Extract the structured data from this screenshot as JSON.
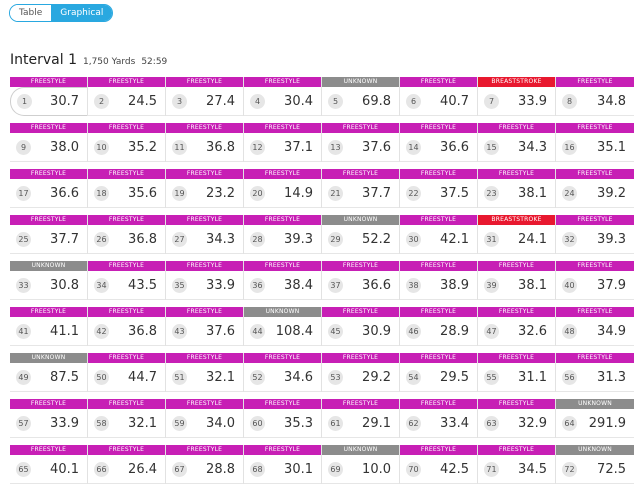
{
  "view_toggle": {
    "options": [
      "Table",
      "Graphical"
    ],
    "active": "Graphical"
  },
  "interval": {
    "title": "Interval 1",
    "yards": "1,750 Yards",
    "duration": "52:59"
  },
  "stroke_colors": {
    "FREESTYLE": "#c71fb5",
    "UNKNOWN": "#8c8c8c",
    "BREASTSTROKE": "#e8182f"
  },
  "laps": [
    {
      "n": "1",
      "stroke": "FREESTYLE",
      "time": "30.7"
    },
    {
      "n": "2",
      "stroke": "FREESTYLE",
      "time": "24.5"
    },
    {
      "n": "3",
      "stroke": "FREESTYLE",
      "time": "27.4"
    },
    {
      "n": "4",
      "stroke": "FREESTYLE",
      "time": "30.4"
    },
    {
      "n": "5",
      "stroke": "UNKNOWN",
      "time": "69.8"
    },
    {
      "n": "6",
      "stroke": "FREESTYLE",
      "time": "40.7"
    },
    {
      "n": "7",
      "stroke": "BREASTSTROKE",
      "time": "33.9"
    },
    {
      "n": "8",
      "stroke": "FREESTYLE",
      "time": "34.8"
    },
    {
      "n": "9",
      "stroke": "FREESTYLE",
      "time": "38.0"
    },
    {
      "n": "10",
      "stroke": "FREESTYLE",
      "time": "35.2"
    },
    {
      "n": "11",
      "stroke": "FREESTYLE",
      "time": "36.8"
    },
    {
      "n": "12",
      "stroke": "FREESTYLE",
      "time": "37.1"
    },
    {
      "n": "13",
      "stroke": "FREESTYLE",
      "time": "37.6"
    },
    {
      "n": "14",
      "stroke": "FREESTYLE",
      "time": "36.6"
    },
    {
      "n": "15",
      "stroke": "FREESTYLE",
      "time": "34.3"
    },
    {
      "n": "16",
      "stroke": "FREESTYLE",
      "time": "35.1"
    },
    {
      "n": "17",
      "stroke": "FREESTYLE",
      "time": "36.6"
    },
    {
      "n": "18",
      "stroke": "FREESTYLE",
      "time": "35.6"
    },
    {
      "n": "19",
      "stroke": "FREESTYLE",
      "time": "23.2"
    },
    {
      "n": "20",
      "stroke": "FREESTYLE",
      "time": "14.9"
    },
    {
      "n": "21",
      "stroke": "FREESTYLE",
      "time": "37.7"
    },
    {
      "n": "22",
      "stroke": "FREESTYLE",
      "time": "37.5"
    },
    {
      "n": "23",
      "stroke": "FREESTYLE",
      "time": "38.1"
    },
    {
      "n": "24",
      "stroke": "FREESTYLE",
      "time": "39.2"
    },
    {
      "n": "25",
      "stroke": "FREESTYLE",
      "time": "37.7"
    },
    {
      "n": "26",
      "stroke": "FREESTYLE",
      "time": "36.8"
    },
    {
      "n": "27",
      "stroke": "FREESTYLE",
      "time": "34.3"
    },
    {
      "n": "28",
      "stroke": "FREESTYLE",
      "time": "39.3"
    },
    {
      "n": "29",
      "stroke": "UNKNOWN",
      "time": "52.2"
    },
    {
      "n": "30",
      "stroke": "FREESTYLE",
      "time": "42.1"
    },
    {
      "n": "31",
      "stroke": "BREASTSTROKE",
      "time": "24.1"
    },
    {
      "n": "32",
      "stroke": "FREESTYLE",
      "time": "39.3"
    },
    {
      "n": "33",
      "stroke": "UNKNOWN",
      "time": "30.8"
    },
    {
      "n": "34",
      "stroke": "FREESTYLE",
      "time": "43.5"
    },
    {
      "n": "35",
      "stroke": "FREESTYLE",
      "time": "33.9"
    },
    {
      "n": "36",
      "stroke": "FREESTYLE",
      "time": "38.4"
    },
    {
      "n": "37",
      "stroke": "FREESTYLE",
      "time": "36.6"
    },
    {
      "n": "38",
      "stroke": "FREESTYLE",
      "time": "38.9"
    },
    {
      "n": "39",
      "stroke": "FREESTYLE",
      "time": "38.1"
    },
    {
      "n": "40",
      "stroke": "FREESTYLE",
      "time": "37.9"
    },
    {
      "n": "41",
      "stroke": "FREESTYLE",
      "time": "41.1"
    },
    {
      "n": "42",
      "stroke": "FREESTYLE",
      "time": "36.8"
    },
    {
      "n": "43",
      "stroke": "FREESTYLE",
      "time": "37.6"
    },
    {
      "n": "44",
      "stroke": "UNKNOWN",
      "time": "108.4"
    },
    {
      "n": "45",
      "stroke": "FREESTYLE",
      "time": "30.9"
    },
    {
      "n": "46",
      "stroke": "FREESTYLE",
      "time": "28.9"
    },
    {
      "n": "47",
      "stroke": "FREESTYLE",
      "time": "32.6"
    },
    {
      "n": "48",
      "stroke": "FREESTYLE",
      "time": "34.9"
    },
    {
      "n": "49",
      "stroke": "UNKNOWN",
      "time": "87.5"
    },
    {
      "n": "50",
      "stroke": "FREESTYLE",
      "time": "44.7"
    },
    {
      "n": "51",
      "stroke": "FREESTYLE",
      "time": "32.1"
    },
    {
      "n": "52",
      "stroke": "FREESTYLE",
      "time": "34.6"
    },
    {
      "n": "53",
      "stroke": "FREESTYLE",
      "time": "29.2"
    },
    {
      "n": "54",
      "stroke": "FREESTYLE",
      "time": "29.5"
    },
    {
      "n": "55",
      "stroke": "FREESTYLE",
      "time": "31.1"
    },
    {
      "n": "56",
      "stroke": "FREESTYLE",
      "time": "31.3"
    },
    {
      "n": "57",
      "stroke": "FREESTYLE",
      "time": "33.9"
    },
    {
      "n": "58",
      "stroke": "FREESTYLE",
      "time": "32.1"
    },
    {
      "n": "59",
      "stroke": "FREESTYLE",
      "time": "34.0"
    },
    {
      "n": "60",
      "stroke": "FREESTYLE",
      "time": "35.3"
    },
    {
      "n": "61",
      "stroke": "FREESTYLE",
      "time": "29.1"
    },
    {
      "n": "62",
      "stroke": "FREESTYLE",
      "time": "33.4"
    },
    {
      "n": "63",
      "stroke": "FREESTYLE",
      "time": "32.9"
    },
    {
      "n": "64",
      "stroke": "UNKNOWN",
      "time": "291.9"
    },
    {
      "n": "65",
      "stroke": "FREESTYLE",
      "time": "40.1"
    },
    {
      "n": "66",
      "stroke": "FREESTYLE",
      "time": "26.4"
    },
    {
      "n": "67",
      "stroke": "FREESTYLE",
      "time": "28.8"
    },
    {
      "n": "68",
      "stroke": "FREESTYLE",
      "time": "30.1"
    },
    {
      "n": "69",
      "stroke": "UNKNOWN",
      "time": "10.0"
    },
    {
      "n": "70",
      "stroke": "FREESTYLE",
      "time": "42.5"
    },
    {
      "n": "71",
      "stroke": "FREESTYLE",
      "time": "34.5"
    },
    {
      "n": "72",
      "stroke": "UNKNOWN",
      "time": "72.5"
    }
  ]
}
